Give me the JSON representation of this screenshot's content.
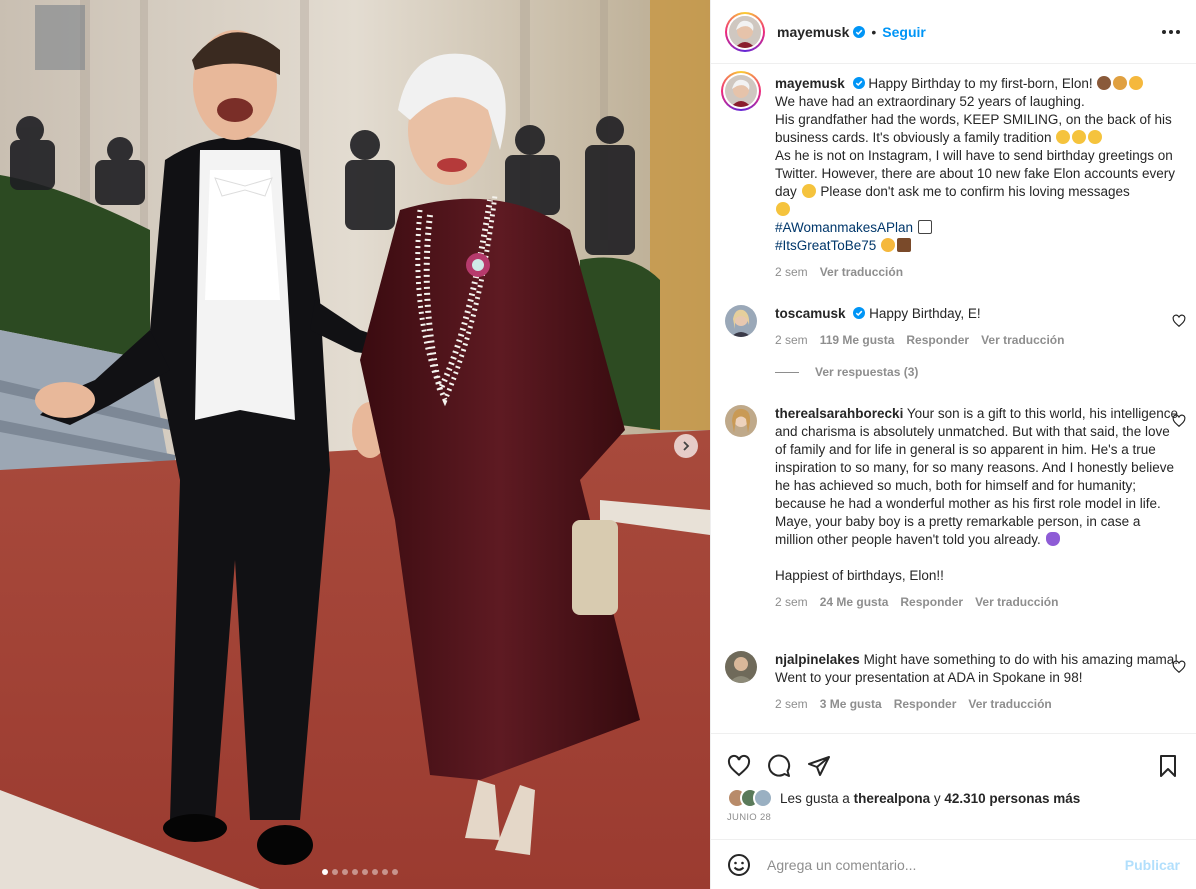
{
  "header": {
    "username": "mayemusk",
    "separator": "•",
    "follow_label": "Seguir"
  },
  "caption": {
    "username": "mayemusk",
    "line1": "Happy Birthday to my first-born, Elon!",
    "line2": "We have had an extraordinary 52 years of laughing.",
    "line3": "His grandfather had the words, KEEP SMILING, on the back of his business cards. It's obviously a family tradition",
    "line4": "As he is not on Instagram, I will have to send birthday greetings on Twitter. However, there are about 10 new fake Elon accounts every day",
    "line4b": "Please don't ask me to confirm his loving messages",
    "hashtag1": "#AWomanmakesAPlan",
    "hashtag2": "#ItsGreatToBe75",
    "time": "2 sem",
    "translate": "Ver traducción"
  },
  "comments": [
    {
      "username": "toscamusk",
      "text": "Happy Birthday, E!",
      "time": "2 sem",
      "likes": "119 Me gusta",
      "reply": "Responder",
      "translate": "Ver traducción",
      "view_replies": "Ver respuestas (3)"
    },
    {
      "username": "therealsarahborecki",
      "text": "Your son is a gift to this world, his intelligence and charisma is absolutely unmatched. But with that said, the love of family and for life in general is so apparent in him. He's a true inspiration to so many, for so many reasons. And I honestly believe he has achieved so much, both for himself and for humanity; because he had a wonderful mother as his first role model in life.",
      "text2": "Maye, your baby boy is a pretty remarkable person, in case a million other people haven't told you already.",
      "text3": "Happiest of birthdays, Elon!!",
      "time": "2 sem",
      "likes": "24 Me gusta",
      "reply": "Responder",
      "translate": "Ver traducción"
    },
    {
      "username": "njalpinelakes",
      "text": "Might have something to do with his amazing mama! Went to your presentation at ADA in Spokane in 98!",
      "time": "2 sem",
      "likes": "3 Me gusta",
      "reply": "Responder",
      "translate": "Ver traducción"
    }
  ],
  "likes_bar": {
    "prefix": "Les gusta a",
    "liker": "therealpona",
    "connector": "y",
    "others": "42.310 personas más"
  },
  "post_date": "JUNIO 28",
  "add_comment": {
    "placeholder": "Agrega un comentario...",
    "publish_label": "Publicar"
  },
  "carousel": {
    "total": 8,
    "active": 1
  },
  "colors": {
    "link_blue": "#0095f6",
    "hashtag": "#00376b",
    "muted": "#8e8e8e",
    "publish_disabled": "#b2dffc"
  },
  "icons": {
    "verified": "verified-badge-icon",
    "more": "more-options-icon",
    "heart": "heart-icon",
    "comment": "comment-icon",
    "share": "share-icon",
    "save": "bookmark-icon",
    "emoji": "emoji-icon",
    "next": "chevron-right-icon"
  }
}
